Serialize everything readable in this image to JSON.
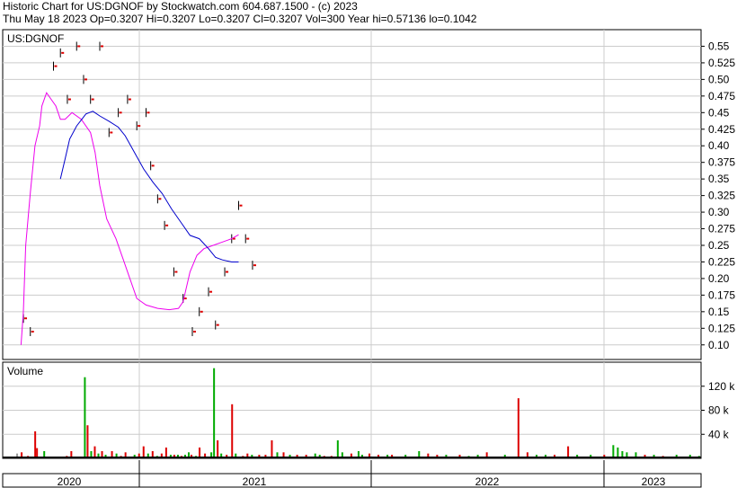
{
  "header": {
    "line1": "Historic Chart for US:DGNOF by Stockwatch.com 604.687.1500 - (c) 2023",
    "line2": "Thu May 18 2023   Op=0.3207   Hi=0.3207   Lo=0.3207   Cl=0.3207   Vol=300   Year hi=0.57136   lo=0.1042"
  },
  "chart_data": [
    {
      "type": "line",
      "panel": "price",
      "symbol_label": "US:DGNOF",
      "y_ticks": [
        "0.55",
        "0.525",
        "0.50",
        "0.475",
        "0.45",
        "0.425",
        "0.40",
        "0.375",
        "0.35",
        "0.325",
        "0.30",
        "0.275",
        "0.25",
        "0.225",
        "0.20",
        "0.175",
        "0.15",
        "0.125",
        "0.10"
      ],
      "ylim": [
        0.078,
        0.575
      ],
      "x_labels": [
        "2020",
        "2021",
        "2022",
        "2023"
      ],
      "grid": true,
      "colors": {
        "price_bar": "#000000",
        "close_tick": "#dd0000",
        "ma_short": "#ee00ee",
        "ma_long": "#0000cc"
      },
      "series": [
        {
          "style": "ohlc",
          "values": [
            [
              0.07,
              0.14
            ],
            [
              0.1,
              0.12
            ],
            [
              0.2,
              0.52
            ],
            [
              0.23,
              0.54
            ],
            [
              0.26,
              0.47
            ],
            [
              0.3,
              0.55
            ],
            [
              0.33,
              0.5
            ],
            [
              0.36,
              0.47
            ],
            [
              0.4,
              0.55
            ],
            [
              0.44,
              0.42
            ],
            [
              0.48,
              0.45
            ],
            [
              0.52,
              0.47
            ],
            [
              0.56,
              0.43
            ],
            [
              0.6,
              0.45
            ],
            [
              0.62,
              0.37
            ],
            [
              0.65,
              0.32
            ],
            [
              0.68,
              0.28
            ],
            [
              0.72,
              0.21
            ],
            [
              0.76,
              0.17
            ],
            [
              0.8,
              0.12
            ],
            [
              0.83,
              0.15
            ],
            [
              0.87,
              0.18
            ],
            [
              0.9,
              0.13
            ],
            [
              0.94,
              0.21
            ],
            [
              0.97,
              0.26
            ],
            [
              1.0,
              0.31
            ],
            [
              1.03,
              0.26
            ],
            [
              1.06,
              0.22
            ]
          ]
        },
        {
          "style": "line",
          "values": [
            [
              0.06,
              0.1
            ],
            [
              0.07,
              0.15
            ],
            [
              0.08,
              0.25
            ],
            [
              0.1,
              0.33
            ],
            [
              0.12,
              0.4
            ],
            [
              0.14,
              0.43
            ],
            [
              0.15,
              0.46
            ],
            [
              0.17,
              0.48
            ],
            [
              0.19,
              0.47
            ],
            [
              0.21,
              0.46
            ],
            [
              0.23,
              0.44
            ],
            [
              0.25,
              0.44
            ],
            [
              0.28,
              0.45
            ],
            [
              0.32,
              0.44
            ],
            [
              0.36,
              0.42
            ],
            [
              0.38,
              0.39
            ],
            [
              0.4,
              0.34
            ],
            [
              0.43,
              0.29
            ],
            [
              0.47,
              0.26
            ],
            [
              0.5,
              0.23
            ],
            [
              0.53,
              0.2
            ],
            [
              0.56,
              0.17
            ],
            [
              0.6,
              0.16
            ],
            [
              0.65,
              0.155
            ],
            [
              0.7,
              0.153
            ],
            [
              0.74,
              0.155
            ],
            [
              0.76,
              0.165
            ],
            [
              0.79,
              0.21
            ],
            [
              0.82,
              0.235
            ],
            [
              0.85,
              0.245
            ],
            [
              0.89,
              0.25
            ],
            [
              0.93,
              0.255
            ],
            [
              0.97,
              0.26
            ],
            [
              1.0,
              0.266
            ]
          ]
        },
        {
          "style": "line",
          "values": [
            [
              0.23,
              0.35
            ],
            [
              0.25,
              0.38
            ],
            [
              0.27,
              0.41
            ],
            [
              0.3,
              0.43
            ],
            [
              0.34,
              0.448
            ],
            [
              0.37,
              0.452
            ],
            [
              0.4,
              0.445
            ],
            [
              0.44,
              0.437
            ],
            [
              0.48,
              0.428
            ],
            [
              0.51,
              0.415
            ],
            [
              0.55,
              0.39
            ],
            [
              0.59,
              0.365
            ],
            [
              0.63,
              0.345
            ],
            [
              0.67,
              0.328
            ],
            [
              0.71,
              0.305
            ],
            [
              0.75,
              0.285
            ],
            [
              0.79,
              0.265
            ],
            [
              0.83,
              0.26
            ],
            [
              0.87,
              0.245
            ],
            [
              0.9,
              0.232
            ],
            [
              0.93,
              0.228
            ],
            [
              0.97,
              0.225
            ],
            [
              1.0,
              0.225
            ]
          ]
        }
      ]
    },
    {
      "type": "bar",
      "panel": "volume",
      "title": "Volume",
      "y_ticks": [
        "120 k",
        "80 k",
        "40 k"
      ],
      "ylim": [
        0,
        160
      ],
      "colors": {
        "up": "#00aa00",
        "down": "#dd0000",
        "flat": "#999999"
      },
      "values": [
        [
          0.1,
          8,
          "flat"
        ],
        [
          0.15,
          10,
          "down"
        ],
        [
          0.22,
          4,
          "down"
        ],
        [
          0.3,
          45,
          "down"
        ],
        [
          0.32,
          17,
          "down"
        ],
        [
          0.4,
          12,
          "up"
        ],
        [
          0.55,
          3,
          "down"
        ],
        [
          0.6,
          3,
          "down"
        ],
        [
          0.65,
          4,
          "down"
        ],
        [
          0.7,
          12,
          "down"
        ],
        [
          0.85,
          135,
          "up"
        ],
        [
          0.88,
          55,
          "down"
        ],
        [
          0.92,
          12,
          "up"
        ],
        [
          0.96,
          20,
          "down"
        ],
        [
          1.0,
          8,
          "up"
        ],
        [
          1.04,
          12,
          "down"
        ],
        [
          1.08,
          6,
          "up"
        ],
        [
          1.15,
          12,
          "down"
        ],
        [
          1.2,
          8,
          "up"
        ],
        [
          1.25,
          4,
          "down"
        ],
        [
          1.3,
          10,
          "down"
        ],
        [
          1.4,
          6,
          "up"
        ],
        [
          1.45,
          8,
          "down"
        ],
        [
          1.5,
          20,
          "down"
        ],
        [
          1.55,
          8,
          "up"
        ],
        [
          1.6,
          12,
          "down"
        ],
        [
          1.65,
          4,
          "up"
        ],
        [
          1.7,
          8,
          "down"
        ],
        [
          1.75,
          18,
          "down"
        ],
        [
          1.8,
          6,
          "up"
        ],
        [
          1.84,
          6,
          "down"
        ],
        [
          1.88,
          6,
          "up"
        ],
        [
          1.92,
          4,
          "down"
        ],
        [
          1.96,
          6,
          "up"
        ],
        [
          2.0,
          10,
          "up"
        ],
        [
          2.03,
          6,
          "down"
        ],
        [
          2.08,
          4,
          "up"
        ],
        [
          2.12,
          18,
          "down"
        ],
        [
          2.18,
          8,
          "down"
        ],
        [
          2.25,
          10,
          "up"
        ],
        [
          2.28,
          150,
          "up"
        ],
        [
          2.32,
          30,
          "down"
        ],
        [
          2.36,
          8,
          "up"
        ],
        [
          2.42,
          6,
          "down"
        ],
        [
          2.48,
          90,
          "down"
        ],
        [
          2.52,
          8,
          "up"
        ],
        [
          2.6,
          4,
          "down"
        ],
        [
          2.65,
          8,
          "down"
        ],
        [
          2.7,
          6,
          "up"
        ],
        [
          2.78,
          6,
          "down"
        ],
        [
          2.85,
          6,
          "down"
        ],
        [
          2.92,
          30,
          "down"
        ],
        [
          2.98,
          10,
          "up"
        ],
        [
          3.05,
          10,
          "down"
        ],
        [
          3.12,
          6,
          "up"
        ],
        [
          3.2,
          6,
          "down"
        ],
        [
          3.3,
          6,
          "down"
        ],
        [
          3.4,
          8,
          "up"
        ],
        [
          3.45,
          6,
          "up"
        ],
        [
          3.5,
          4,
          "down"
        ],
        [
          3.58,
          4,
          "down"
        ],
        [
          3.65,
          30,
          "up"
        ],
        [
          3.7,
          10,
          "up"
        ],
        [
          3.8,
          8,
          "down"
        ],
        [
          3.88,
          12,
          "up"
        ],
        [
          3.92,
          6,
          "up"
        ],
        [
          4.0,
          8,
          "down"
        ],
        [
          4.1,
          6,
          "down"
        ],
        [
          4.2,
          6,
          "up"
        ],
        [
          4.25,
          6,
          "down"
        ],
        [
          4.4,
          6,
          "up"
        ],
        [
          4.55,
          12,
          "up"
        ],
        [
          4.65,
          8,
          "down"
        ],
        [
          4.75,
          6,
          "down"
        ],
        [
          4.85,
          6,
          "up"
        ],
        [
          5.0,
          6,
          "down"
        ],
        [
          5.1,
          4,
          "up"
        ],
        [
          5.2,
          6,
          "up"
        ],
        [
          5.3,
          10,
          "down"
        ],
        [
          5.5,
          6,
          "up"
        ],
        [
          5.65,
          100,
          "down"
        ],
        [
          5.75,
          10,
          "down"
        ],
        [
          5.85,
          6,
          "up"
        ],
        [
          5.95,
          6,
          "up"
        ],
        [
          6.05,
          6,
          "down"
        ],
        [
          6.2,
          20,
          "down"
        ],
        [
          6.3,
          6,
          "up"
        ],
        [
          6.45,
          6,
          "up"
        ],
        [
          6.6,
          6,
          "down"
        ],
        [
          6.7,
          22,
          "up"
        ],
        [
          6.75,
          18,
          "up"
        ],
        [
          6.8,
          12,
          "up"
        ],
        [
          6.85,
          10,
          "up"
        ],
        [
          6.95,
          10,
          "up"
        ],
        [
          7.05,
          6,
          "down"
        ],
        [
          7.15,
          6,
          "up"
        ],
        [
          7.25,
          4,
          "down"
        ],
        [
          7.4,
          6,
          "up"
        ],
        [
          7.55,
          6,
          "up"
        ],
        [
          7.65,
          4,
          "up"
        ]
      ]
    }
  ]
}
